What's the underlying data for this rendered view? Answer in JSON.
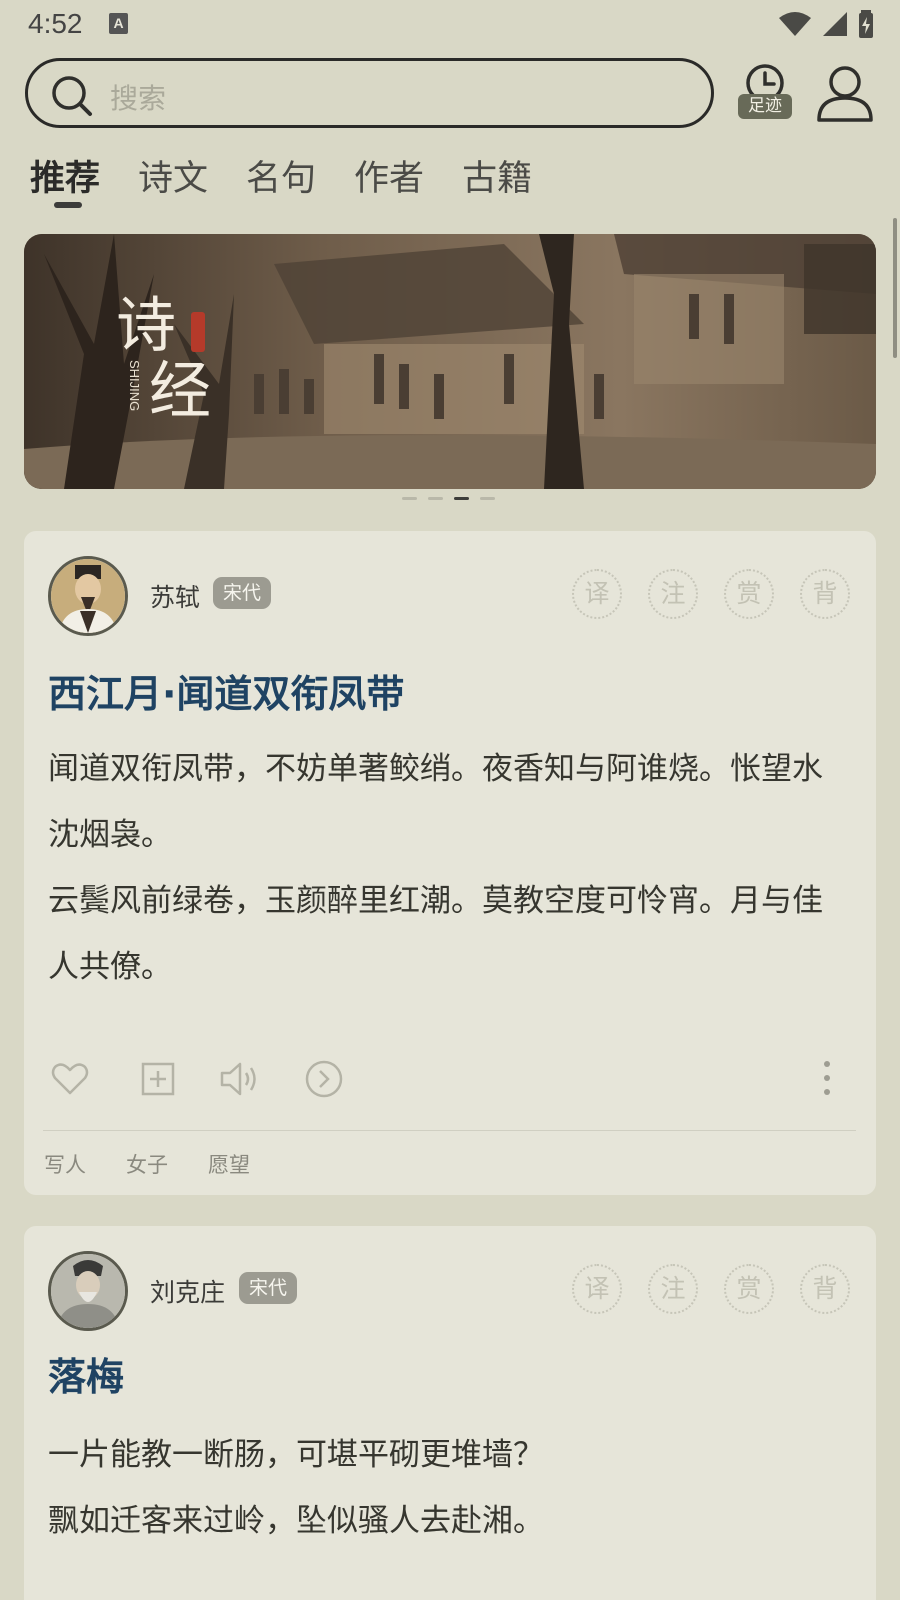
{
  "status_bar": {
    "time": "4:52",
    "input_method": "A"
  },
  "search": {
    "placeholder": "搜索"
  },
  "history": {
    "label": "足迹"
  },
  "tabs": [
    {
      "label": "推荐",
      "active": true
    },
    {
      "label": "诗文"
    },
    {
      "label": "名句"
    },
    {
      "label": "作者"
    },
    {
      "label": "古籍"
    }
  ],
  "banner": {
    "title_line1": "诗",
    "title_line2": "经",
    "pinyin": "SHIJING",
    "seal": "诗经",
    "slides": 4,
    "active_slide": 3
  },
  "poem_actions": [
    "译",
    "注",
    "赏",
    "背"
  ],
  "cards": [
    {
      "author": "苏轼",
      "dynasty": "宋代",
      "title": "西江月·闻道双衔凤带",
      "lines": [
        "闻道双衔凤带，不妨单著鲛绡。夜香知与阿谁烧。怅望水沈烟袅。",
        "云鬓风前绿卷，玉颜醉里红潮。莫教空度可怜宵。月与佳人共僚。"
      ],
      "tags": [
        "写人",
        "女子",
        "愿望"
      ]
    },
    {
      "author": "刘克庄",
      "dynasty": "宋代",
      "title": "落梅",
      "lines": [
        "一片能教一断肠，可堪平砌更堆墙？",
        "飘如迁客来过岭，坠似骚人去赴湘。"
      ]
    }
  ],
  "colors": {
    "background": "#d9d8c6",
    "card": "#e6e5d9",
    "title": "#1f4363"
  }
}
